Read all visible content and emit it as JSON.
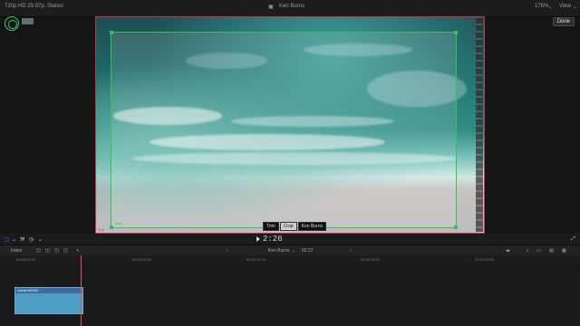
{
  "header": {
    "format": "720p HD 29.97p, Stereo",
    "mode_title": "Ken Burns",
    "zoom": "176%",
    "view_label": "View"
  },
  "viewer": {
    "done_label": "Done",
    "start_label": "Start",
    "end_label": "End",
    "modes": [
      "Trim",
      "Crop",
      "Ken Burns"
    ],
    "active_mode": "Crop"
  },
  "playback": {
    "timecode": "2:26"
  },
  "timeline": {
    "index_label": "Index",
    "project_name": "Ken Burns",
    "project_duration": "02:27",
    "ruler_ticks": [
      "00:00:00:00",
      "00:00:05:00",
      "00:00:10:00",
      "00:00:15:00",
      "00:00:20:00"
    ],
    "clip_label": "ocean 65350"
  },
  "colors": {
    "start_crop": "#39c24f",
    "end_crop": "#c8324b",
    "clip": "#4f9cc4",
    "playhead": "#dd5555"
  }
}
